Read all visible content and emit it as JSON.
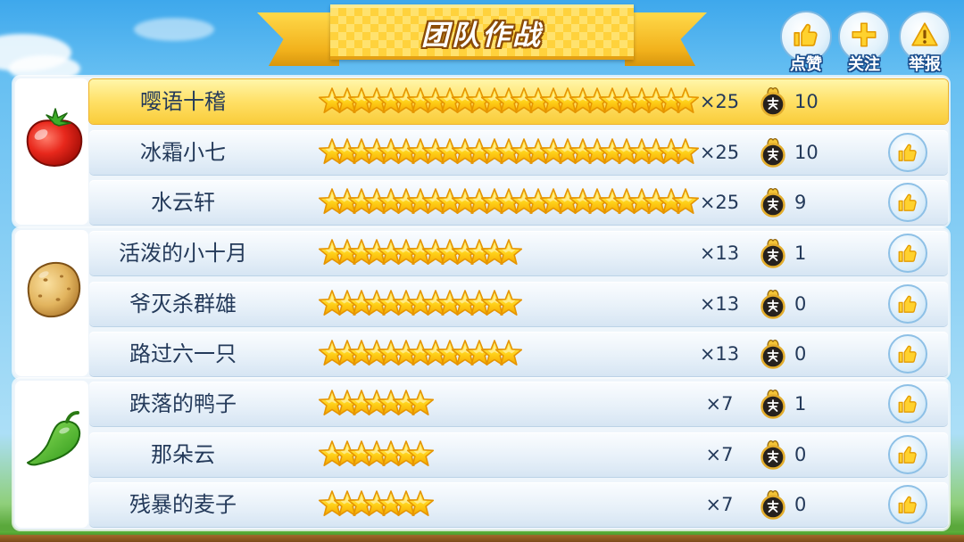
{
  "header": {
    "title": "团队作战"
  },
  "top_actions": {
    "like": {
      "label": "点赞",
      "icon": "thumbs-up-icon"
    },
    "follow": {
      "label": "关注",
      "icon": "plus-icon"
    },
    "report": {
      "label": "举报",
      "icon": "warning-icon"
    }
  },
  "score_icon": "medal-icon",
  "groups": [
    {
      "icon": "tomato-icon",
      "rows": [
        {
          "name": "嘤语十稽",
          "stars": 25,
          "multiplier": "×25",
          "score": "10",
          "highlighted": true,
          "like_button": false
        },
        {
          "name": "冰霜小七",
          "stars": 25,
          "multiplier": "×25",
          "score": "10",
          "highlighted": false,
          "like_button": true
        },
        {
          "name": "水云轩",
          "stars": 25,
          "multiplier": "×25",
          "score": "9",
          "highlighted": false,
          "like_button": true
        }
      ]
    },
    {
      "icon": "potato-icon",
      "rows": [
        {
          "name": "活泼的小十月",
          "stars": 13,
          "multiplier": "×13",
          "score": "1",
          "highlighted": false,
          "like_button": true
        },
        {
          "name": "爷灭杀群雄",
          "stars": 13,
          "multiplier": "×13",
          "score": "0",
          "highlighted": false,
          "like_button": true
        },
        {
          "name": "路过六一只",
          "stars": 13,
          "multiplier": "×13",
          "score": "0",
          "highlighted": false,
          "like_button": true
        }
      ]
    },
    {
      "icon": "pepper-icon",
      "rows": [
        {
          "name": "跌落的鸭子",
          "stars": 7,
          "multiplier": "×7",
          "score": "1",
          "highlighted": false,
          "like_button": true
        },
        {
          "name": "那朵云",
          "stars": 7,
          "multiplier": "×7",
          "score": "0",
          "highlighted": false,
          "like_button": true
        },
        {
          "name": "残暴的麦子",
          "stars": 7,
          "multiplier": "×7",
          "score": "0",
          "highlighted": false,
          "like_button": true
        }
      ]
    }
  ],
  "colors": {
    "text": "#243a5a",
    "highlight": "#fcd648",
    "row": "#e8f1f9",
    "star": "#ffd21a",
    "banner": "#ffd23c"
  }
}
